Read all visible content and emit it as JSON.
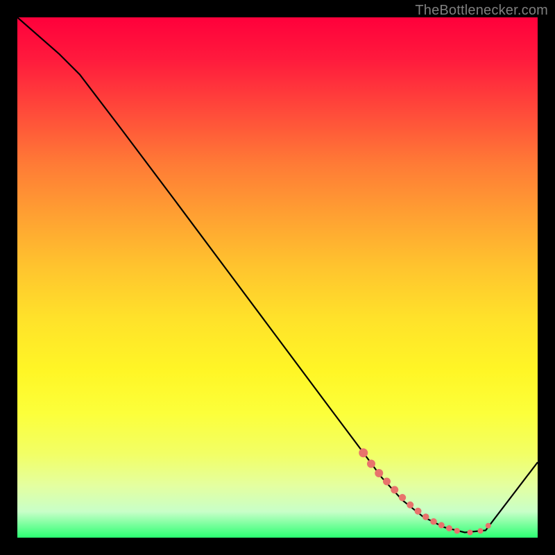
{
  "watermark": "TheBottlenecker.com",
  "chart_data": {
    "type": "line",
    "title": "",
    "xlabel": "",
    "ylabel": "",
    "xlim": [
      0,
      100
    ],
    "ylim": [
      0,
      100
    ],
    "series": [
      {
        "name": "curve",
        "x": [
          0,
          8,
          12,
          20,
          30,
          40,
          50,
          60,
          66,
          70,
          74,
          78,
          82,
          86,
          90,
          100
        ],
        "y": [
          100,
          93,
          89,
          78.5,
          65.2,
          51.8,
          38.4,
          25,
          17,
          11.6,
          7.2,
          4.0,
          2.0,
          1.0,
          1.4,
          14.5
        ]
      }
    ],
    "highlight_dots": {
      "x": [
        66.5,
        68,
        69.5,
        71,
        72.5,
        74,
        75.5,
        77,
        78.5,
        80,
        81.5,
        83,
        84.5,
        87,
        89,
        90.5
      ],
      "y": [
        16.3,
        14.2,
        12.4,
        10.8,
        9.2,
        7.7,
        6.3,
        5.1,
        4.0,
        3.1,
        2.4,
        1.8,
        1.3,
        1.0,
        1.3,
        2.3
      ],
      "r": [
        6.5,
        6.0,
        6.0,
        5.5,
        5.5,
        5.2,
        5.0,
        5.0,
        4.8,
        4.8,
        4.5,
        4.5,
        4.2,
        4.0,
        4.0,
        4.0
      ]
    },
    "background_gradient": {
      "top": "#ff003b",
      "mid": "#ffe22a",
      "bottom": "#2bff72"
    }
  }
}
